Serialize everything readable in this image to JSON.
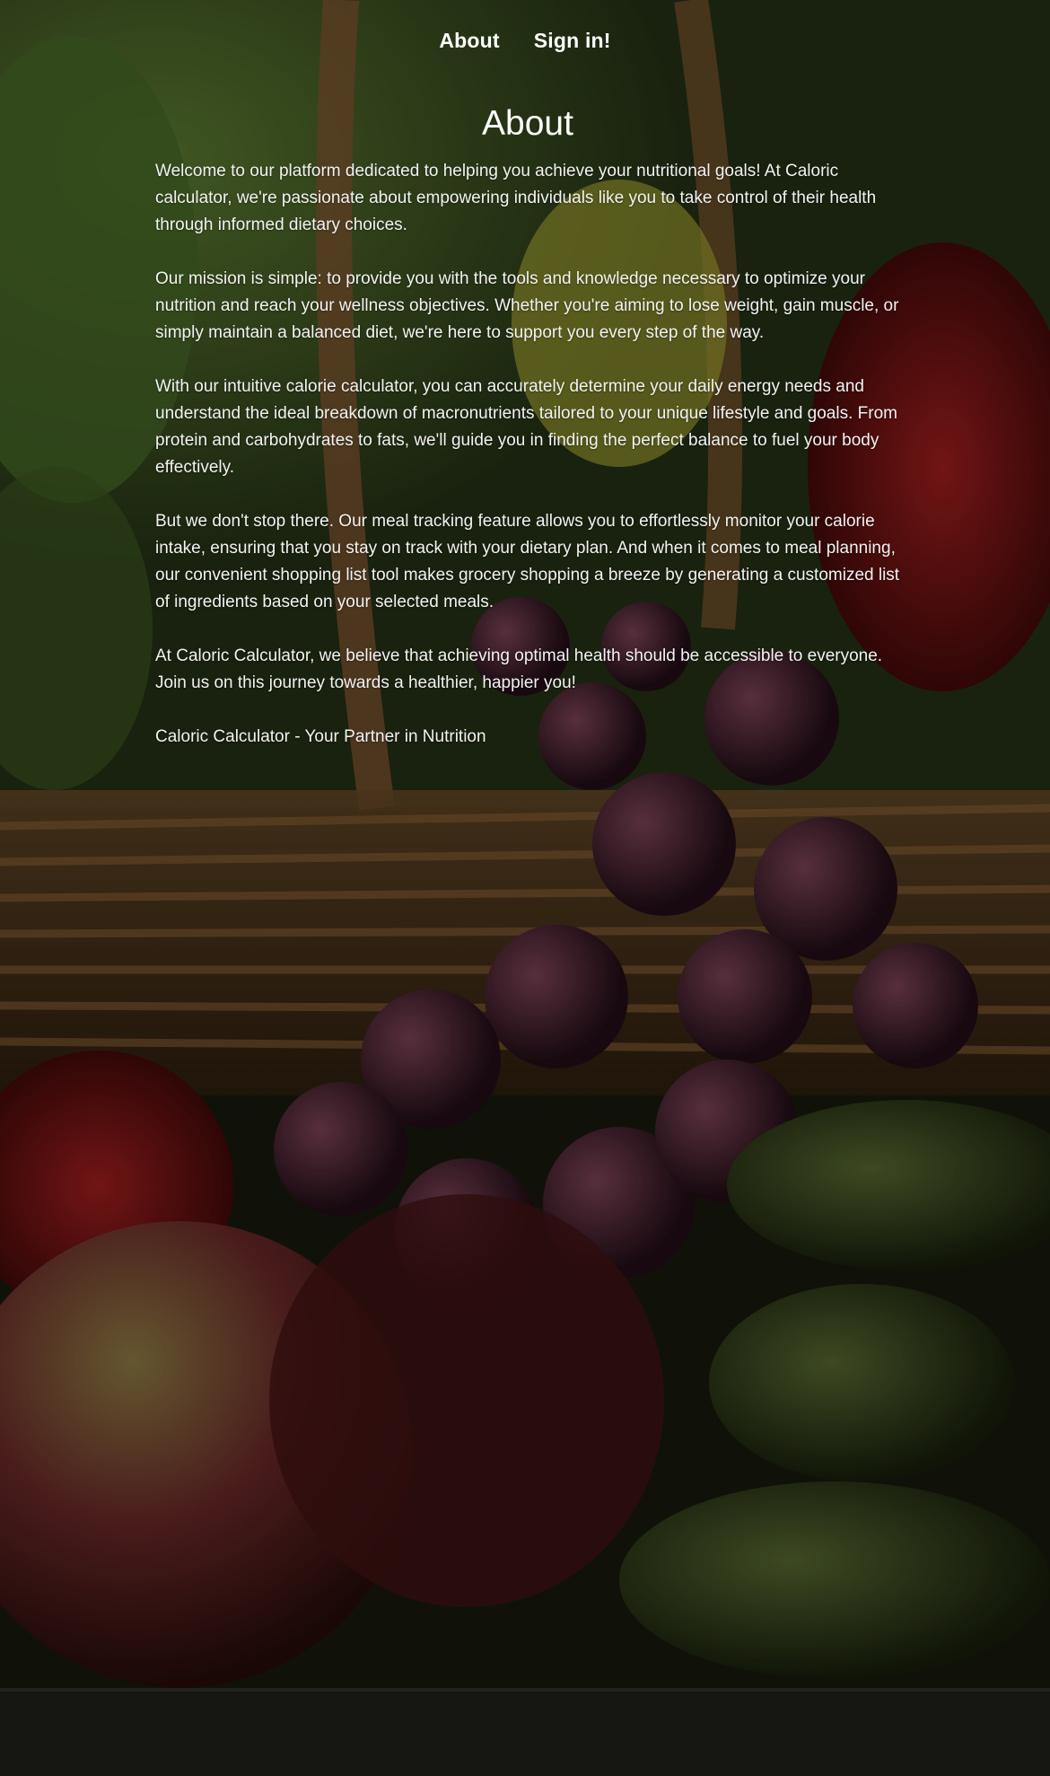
{
  "nav": {
    "about_label": "About",
    "signin_label": "Sign in!"
  },
  "page": {
    "title": "About",
    "paragraphs": [
      "Welcome to our platform dedicated to helping you achieve your nutritional goals! At Caloric calculator, we're passionate about empowering individuals like you to take control of their health through informed dietary choices.",
      "Our mission is simple: to provide you with the tools and knowledge necessary to optimize your nutrition and reach your wellness objectives. Whether you're aiming to lose weight, gain muscle, or simply maintain a balanced diet, we're here to support you every step of the way.",
      "With our intuitive calorie calculator, you can accurately determine your daily energy needs and understand the ideal breakdown of macronutrients tailored to your unique lifestyle and goals. From protein and carbohydrates to fats, we'll guide you in finding the perfect balance to fuel your body effectively.",
      "But we don't stop there. Our meal tracking feature allows you to effortlessly monitor your calorie intake, ensuring that you stay on track with your dietary plan. And when it comes to meal planning, our convenient shopping list tool makes grocery shopping a breeze by generating a customized list of ingredients based on your selected meals.",
      "At Caloric Calculator, we believe that achieving optimal health should be accessible to everyone. Join us on this journey towards a healthier, happier you!",
      "Caloric Calculator - Your Partner in Nutrition"
    ]
  }
}
